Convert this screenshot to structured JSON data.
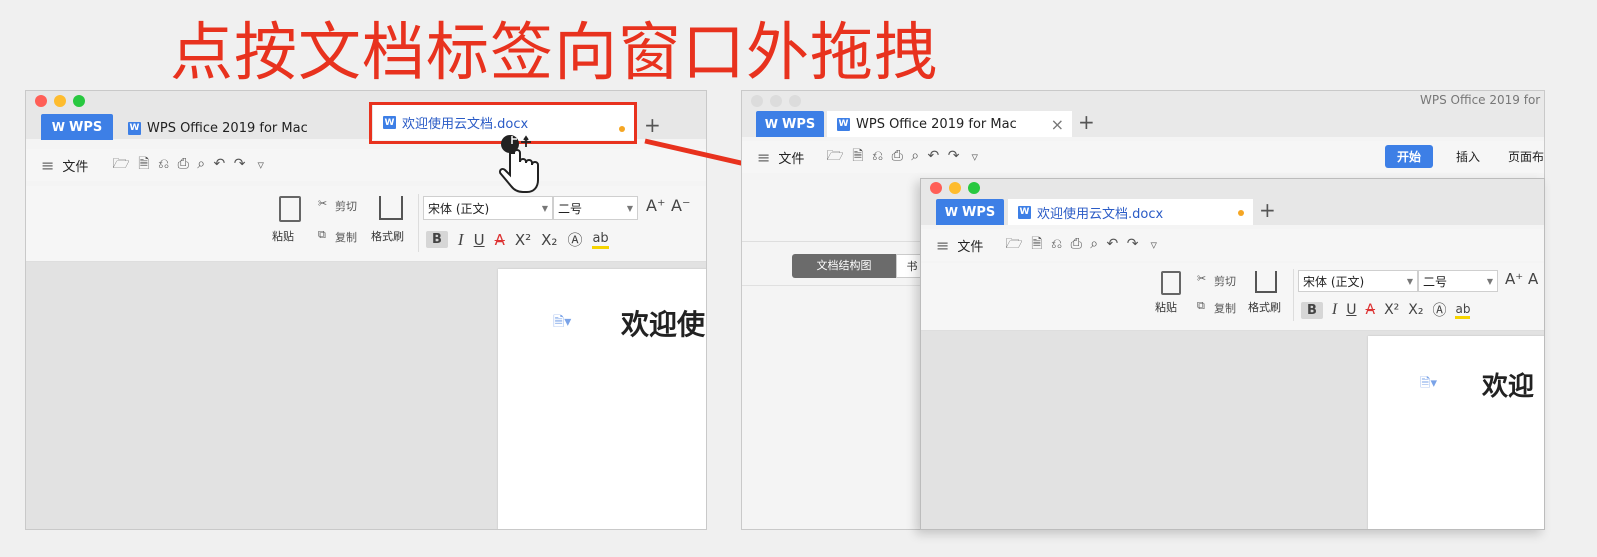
{
  "headline": "点按文档标签向窗口外拖拽",
  "left_window": {
    "tabs": {
      "wps_label": "WPS",
      "tab1_label": "WPS Office 2019 for Mac",
      "tab2_label": "欢迎使用云文档.docx",
      "add": "+"
    },
    "menu": {
      "file_label": "文件",
      "more": "▿"
    },
    "ribbon": {
      "paste": "粘贴",
      "cut": "剪切",
      "copy": "复制",
      "format_painter": "格式刷",
      "font_name": "宋体 (正文)",
      "font_size": "二号",
      "grow": "A⁺",
      "shrink": "A⁻"
    },
    "doc_text": "欢迎使"
  },
  "right_window": {
    "title": "WPS Office 2019 for",
    "tabs": {
      "wps_label": "WPS",
      "tab1_label": "WPS Office 2019 for Mac",
      "close": "×",
      "add": "+"
    },
    "menu": {
      "file_label": "文件",
      "more": "▿"
    },
    "ribbon_tabs": [
      "开始",
      "插入",
      "页面布"
    ],
    "nav_segment": [
      "文档结构图",
      "书"
    ]
  },
  "floating_window": {
    "tabs": {
      "wps_label": "WPS",
      "tab1_label": "欢迎使用云文档.docx",
      "add": "+"
    },
    "menu": {
      "file_label": "文件",
      "more": "▿"
    },
    "ribbon": {
      "paste": "粘贴",
      "cut": "剪切",
      "copy": "复制",
      "format_painter": "格式刷",
      "font_name": "宋体 (正文)",
      "font_size": "二号",
      "grow": "A⁺",
      "shrink": "A"
    },
    "doc_text": "欢迎"
  },
  "colors": {
    "accent": "#3d7fe6",
    "highlight": "#e8321e",
    "modified_dot": "#f5a623"
  }
}
